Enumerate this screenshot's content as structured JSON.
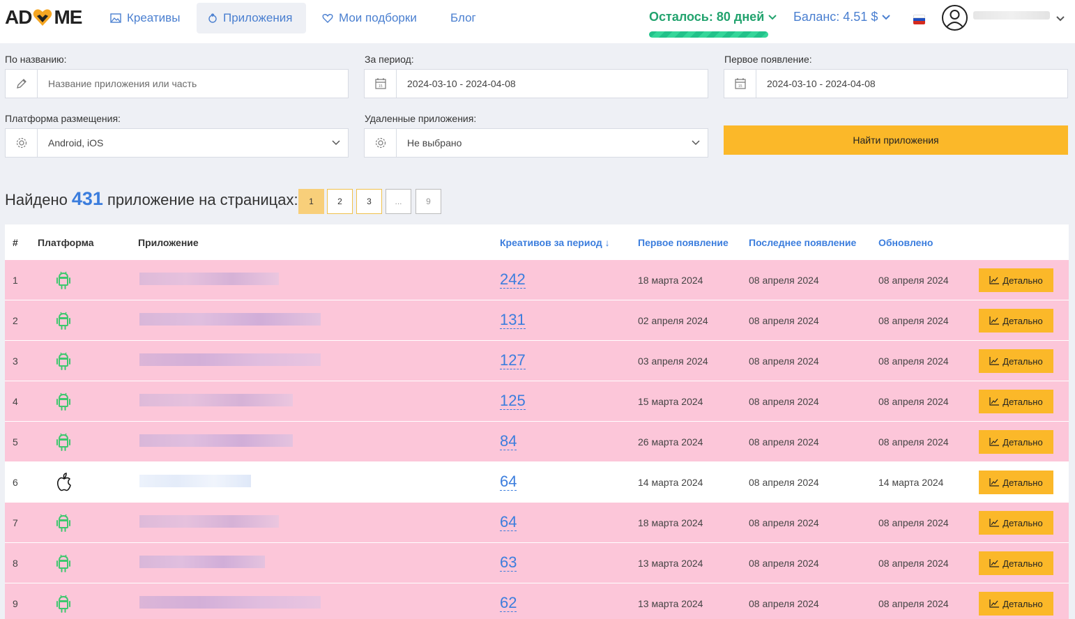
{
  "header": {
    "logo_text_left": "AD",
    "logo_text_right": "ME",
    "nav": [
      {
        "label": "Креативы",
        "icon": "image-icon"
      },
      {
        "label": "Приложения",
        "icon": "apps-icon"
      },
      {
        "label": "Мои подборки",
        "icon": "heart-icon"
      },
      {
        "label": "Блог",
        "icon": ""
      }
    ],
    "days_left": "Осталось: 80 дней",
    "balance": "Баланс: 4.51 $",
    "colors": {
      "accent": "#3b7ddd",
      "green": "#22a36e",
      "button": "#fbb829",
      "row_highlight": "#fcc6d9"
    }
  },
  "filters": {
    "name_label": "По названию:",
    "name_placeholder": "Название приложения или часть",
    "period_label": "За период:",
    "period_value": "2024-03-10 - 2024-04-08",
    "first_label": "Первое появление:",
    "first_value": "2024-03-10 - 2024-04-08",
    "platform_label": "Платформа размещения:",
    "platform_value": "Android, iOS",
    "deleted_label": "Удаленные приложения:",
    "deleted_value": "Не выбрано",
    "find_button": "Найти приложения"
  },
  "results": {
    "prefix": "Найдено",
    "count": "431",
    "suffix": "приложение на страницах:",
    "pages": [
      "1",
      "2",
      "3",
      "...",
      "9"
    ]
  },
  "table": {
    "columns": [
      "#",
      "Платформа",
      "Приложение",
      "Креативов за период ↓",
      "Первое появление",
      "Последнее появление",
      "Обновлено"
    ],
    "detail_label": "Детально",
    "rows": [
      {
        "n": "1",
        "platform": "android",
        "creatives": "242",
        "first": "18 марта 2024",
        "last": "08 апреля 2024",
        "updated": "08 апреля 2024",
        "highlight": true
      },
      {
        "n": "2",
        "platform": "android",
        "creatives": "131",
        "first": "02 апреля 2024",
        "last": "08 апреля 2024",
        "updated": "08 апреля 2024",
        "highlight": true
      },
      {
        "n": "3",
        "platform": "android",
        "creatives": "127",
        "first": "03 апреля 2024",
        "last": "08 апреля 2024",
        "updated": "08 апреля 2024",
        "highlight": true
      },
      {
        "n": "4",
        "platform": "android",
        "creatives": "125",
        "first": "15 марта 2024",
        "last": "08 апреля 2024",
        "updated": "08 апреля 2024",
        "highlight": true
      },
      {
        "n": "5",
        "platform": "android",
        "creatives": "84",
        "first": "26 марта 2024",
        "last": "08 апреля 2024",
        "updated": "08 апреля 2024",
        "highlight": true
      },
      {
        "n": "6",
        "platform": "ios",
        "creatives": "64",
        "first": "14 марта 2024",
        "last": "08 апреля 2024",
        "updated": "14 марта 2024",
        "highlight": false
      },
      {
        "n": "7",
        "platform": "android",
        "creatives": "64",
        "first": "18 марта 2024",
        "last": "08 апреля 2024",
        "updated": "08 апреля 2024",
        "highlight": true
      },
      {
        "n": "8",
        "platform": "android",
        "creatives": "63",
        "first": "13 марта 2024",
        "last": "08 апреля 2024",
        "updated": "08 апреля 2024",
        "highlight": true
      },
      {
        "n": "9",
        "platform": "android",
        "creatives": "62",
        "first": "13 марта 2024",
        "last": "08 апреля 2024",
        "updated": "08 апреля 2024",
        "highlight": true
      }
    ]
  }
}
